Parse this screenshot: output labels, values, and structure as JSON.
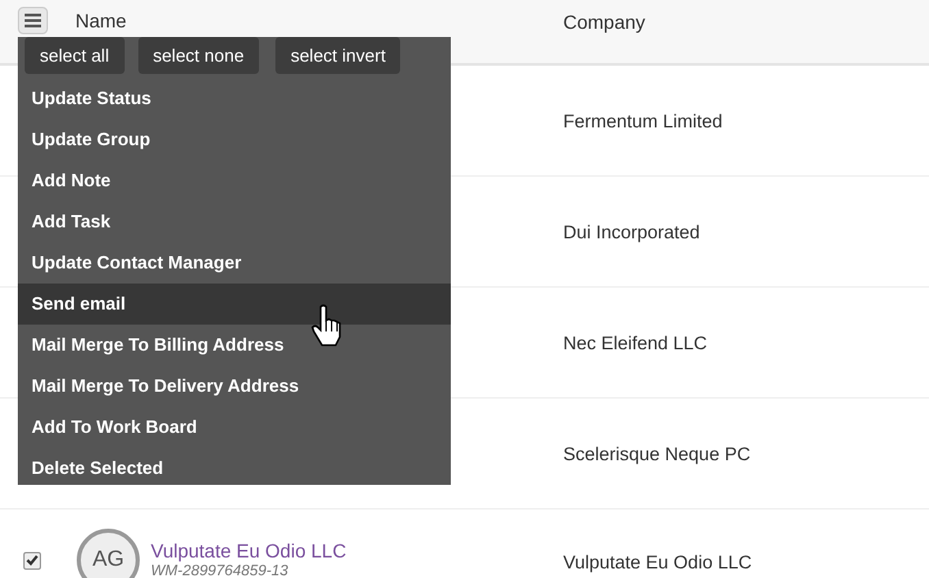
{
  "header": {
    "columns": [
      "Name",
      "Company"
    ]
  },
  "menu": {
    "select_buttons": [
      "select all",
      "select none",
      "select invert"
    ],
    "items": [
      {
        "label": "Update Status",
        "highlighted": false
      },
      {
        "label": "Update Group",
        "highlighted": false
      },
      {
        "label": "Add Note",
        "highlighted": false
      },
      {
        "label": "Add Task",
        "highlighted": false
      },
      {
        "label": "Update Contact Manager",
        "highlighted": false
      },
      {
        "label": "Send email",
        "highlighted": true
      },
      {
        "label": "Mail Merge To Billing Address",
        "highlighted": false
      },
      {
        "label": "Mail Merge To Delivery Address",
        "highlighted": false
      },
      {
        "label": "Add To Work Board",
        "highlighted": false
      },
      {
        "label": "Delete Selected",
        "highlighted": false
      }
    ]
  },
  "rows": [
    {
      "company": "Fermentum Limited"
    },
    {
      "company": "Dui Incorporated"
    },
    {
      "company": "Nec Eleifend LLC"
    },
    {
      "company": "Scelerisque Neque PC"
    },
    {
      "checked": true,
      "initials": "AG",
      "name": "Vulputate Eu Odio LLC",
      "code": "WM-2899764859-13",
      "company": "Vulputate Eu Odio LLC"
    }
  ]
}
